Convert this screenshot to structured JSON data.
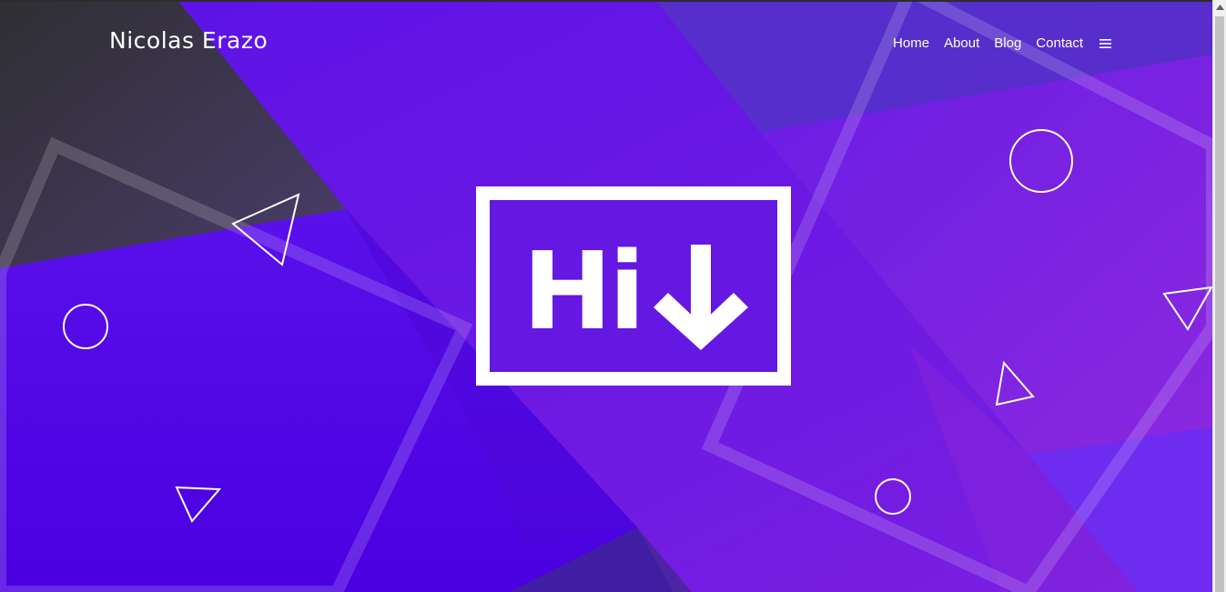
{
  "header": {
    "brand": "Nicolas Erazo",
    "nav": [
      "Home",
      "About",
      "Blog",
      "Contact"
    ],
    "menu_icon": "hamburger-icon"
  },
  "hero": {
    "greeting": "Hi",
    "arrow_icon": "arrow-down-icon"
  },
  "colors": {
    "primary_purple": "#6418e2",
    "deep_blue": "#4a00e0",
    "violet": "#7b1fe0",
    "dark": "#2f2f33",
    "white": "#ffffff"
  }
}
